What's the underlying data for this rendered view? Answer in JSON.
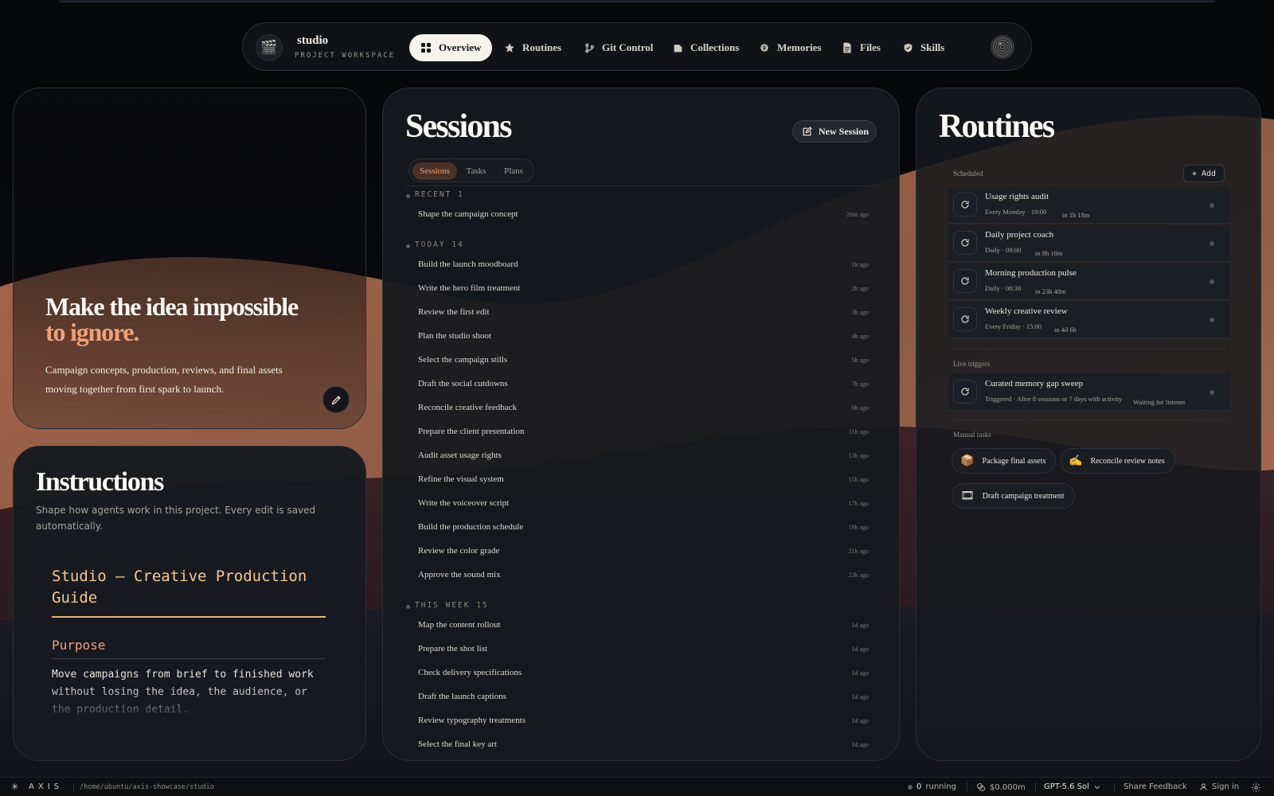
{
  "nav": {
    "brand_name": "studio",
    "brand_sub": "PROJECT WORKSPACE",
    "brand_icon": "clapperboard-icon",
    "items": [
      {
        "label": "Overview",
        "icon": "grid-icon",
        "active": true
      },
      {
        "label": "Routines",
        "icon": "star-icon"
      },
      {
        "label": "Git Control",
        "icon": "git-branch-icon"
      },
      {
        "label": "Collections",
        "icon": "folder-icon"
      },
      {
        "label": "Memories",
        "icon": "brain-icon"
      },
      {
        "label": "Files",
        "icon": "file-icon"
      },
      {
        "label": "Skills",
        "icon": "shield-icon"
      }
    ]
  },
  "hero": {
    "title": "Make the idea impossible",
    "accent": "to ignore.",
    "description": "Campaign concepts, production, reviews, and final assets moving together from first spark to launch."
  },
  "instructions": {
    "title": "Instructions",
    "subtitle": "Shape how agents work in this project. Every edit is saved automatically.",
    "guide_title": "Studio — Creative Production Guide",
    "section_heading": "Purpose",
    "body": "Move campaigns from brief to finished work without losing the idea, the audience, or the production detail."
  },
  "sessions": {
    "title": "Sessions",
    "new_label": "New Session",
    "tabs": [
      "Sessions",
      "Tasks",
      "Plans"
    ],
    "groups": [
      {
        "label": "RECENT 1",
        "items": [
          {
            "name": "Shape the campaign concept",
            "time": "26m ago"
          }
        ]
      },
      {
        "label": "TODAY 14",
        "items": [
          {
            "name": "Build the launch moodboard",
            "time": "1h ago"
          },
          {
            "name": "Write the hero film treatment",
            "time": "2h ago"
          },
          {
            "name": "Review the first edit",
            "time": "3h ago"
          },
          {
            "name": "Plan the studio shoot",
            "time": "4h ago"
          },
          {
            "name": "Select the campaign stills",
            "time": "5h ago"
          },
          {
            "name": "Draft the social cutdowns",
            "time": "7h ago"
          },
          {
            "name": "Reconcile creative feedback",
            "time": "9h ago"
          },
          {
            "name": "Prepare the client presentation",
            "time": "11h ago"
          },
          {
            "name": "Audit asset usage rights",
            "time": "13h ago"
          },
          {
            "name": "Refine the visual system",
            "time": "15h ago"
          },
          {
            "name": "Write the voiceover script",
            "time": "17h ago"
          },
          {
            "name": "Build the production schedule",
            "time": "19h ago"
          },
          {
            "name": "Review the color grade",
            "time": "21h ago"
          },
          {
            "name": "Approve the sound mix",
            "time": "23h ago"
          }
        ]
      },
      {
        "label": "THIS WEEK 15",
        "items": [
          {
            "name": "Map the content rollout",
            "time": "1d ago"
          },
          {
            "name": "Prepare the shot list",
            "time": "1d ago"
          },
          {
            "name": "Check delivery specifications",
            "time": "1d ago"
          },
          {
            "name": "Draft the launch captions",
            "time": "1d ago"
          },
          {
            "name": "Review typography treatments",
            "time": "1d ago"
          },
          {
            "name": "Select the final key art",
            "time": "1d ago"
          }
        ]
      }
    ]
  },
  "routines": {
    "title": "Routines",
    "scheduled_label": "Scheduled",
    "add_label": "+ Add",
    "scheduled": [
      {
        "name": "Usage rights audit",
        "schedule": "Every Monday · 10:00",
        "next": "in 1h 18m"
      },
      {
        "name": "Daily project coach",
        "schedule": "Daily · 09:00",
        "next": "in 8h 18m"
      },
      {
        "name": "Morning production pulse",
        "schedule": "Daily · 08:30",
        "next": "in 23h 48m"
      },
      {
        "name": "Weekly creative review",
        "schedule": "Every Friday · 15:00",
        "next": "in 4d 6h"
      }
    ],
    "live_label": "Live triggers",
    "live": [
      {
        "name": "Curated memory gap sweep",
        "schedule": "Triggered · After 8 sessions or 7 days with activity",
        "next": "Waiting for listener"
      }
    ],
    "manual_label": "Manual tasks",
    "manual": [
      {
        "label": "Package final assets",
        "emoji": "📦"
      },
      {
        "label": "Reconcile review notes",
        "emoji": "✍"
      },
      {
        "label": "Draft campaign treatment",
        "emoji": "🎞"
      }
    ]
  },
  "status": {
    "brand": "AXIS",
    "path": "/home/ubuntu/axis-showcase/studio",
    "running_count": "0",
    "running_label": "running",
    "cost": "$0.000m",
    "model": "GPT-5.6 Sol",
    "feedback": "Share Feedback",
    "signin": "Sign in"
  },
  "colors": {
    "accent": "#f0a074",
    "guide_gold": "#f5c98f",
    "background": "#0b0c0f",
    "panel": "#15181d"
  }
}
